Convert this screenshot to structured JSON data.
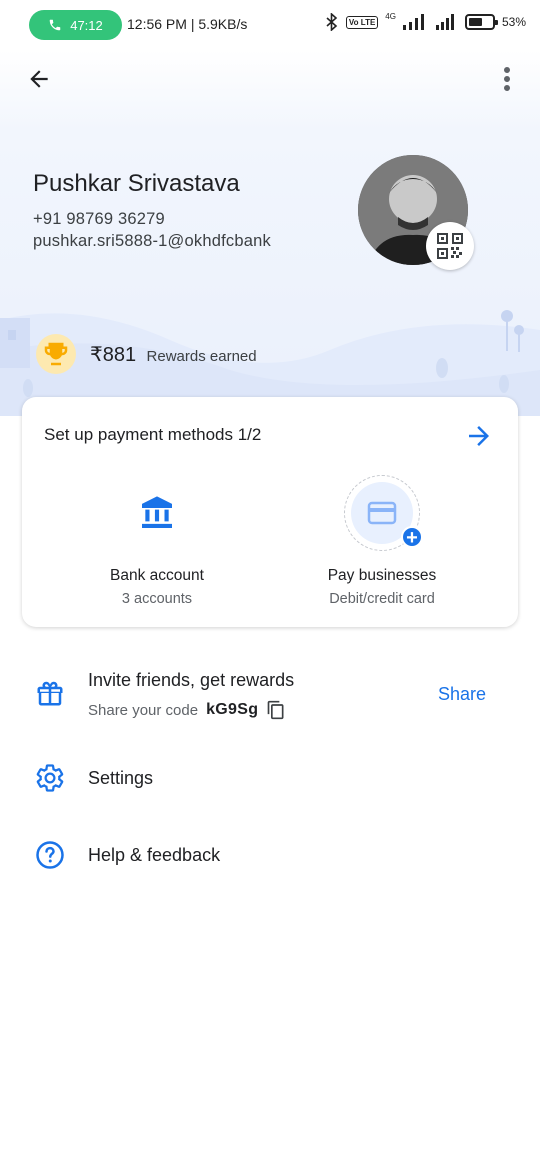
{
  "status_bar": {
    "call_timer": "47:12",
    "time_speed": "12:56 PM | 5.9KB/s",
    "volte": "Vo LTE",
    "network": "4G",
    "battery": "53%"
  },
  "profile": {
    "name": "Pushkar Srivastava",
    "phone": "+91 98769 36279",
    "upi_id": "pushkar.sri5888-1@okhdfcbank"
  },
  "rewards": {
    "amount": "₹881",
    "label": "Rewards earned"
  },
  "payment_setup": {
    "title": "Set up payment methods 1/2",
    "methods": [
      {
        "label": "Bank account",
        "sub": "3 accounts",
        "icon": "bank-icon"
      },
      {
        "label": "Pay businesses",
        "sub": "Debit/credit card",
        "icon": "credit-card-icon"
      }
    ]
  },
  "menu": {
    "invite": {
      "title": "Invite friends, get rewards",
      "sub_label": "Share your code",
      "code": "kG9Sg",
      "share_label": "Share"
    },
    "settings": "Settings",
    "help": "Help & feedback"
  },
  "colors": {
    "accent": "#1a73e8",
    "call_pill": "#33c47a",
    "hero_bg": "#eaf0fc"
  }
}
